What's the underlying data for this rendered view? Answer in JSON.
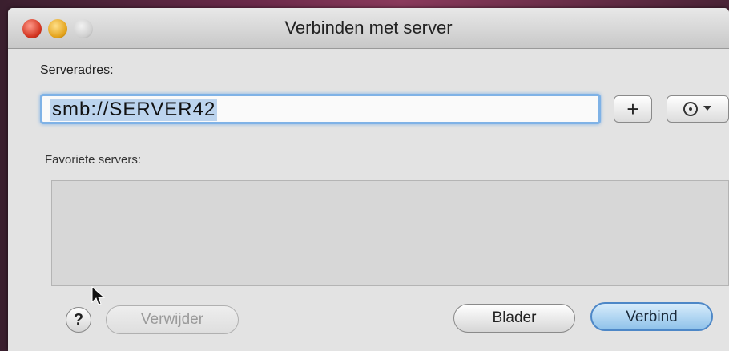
{
  "window": {
    "title": "Verbinden met server"
  },
  "form": {
    "server_label": "Serveradres:",
    "server_value": "smb://SERVER42",
    "add_label": "+",
    "favorites_label": "Favoriete servers:"
  },
  "footer": {
    "help_label": "?",
    "remove_label": "Verwijder",
    "browse_label": "Blader",
    "connect_label": "Verbind"
  },
  "colors": {
    "focus_ring": "#7fb2e6",
    "default_button": "#8fc2ea",
    "close": "#d2331f",
    "minimize": "#e3a21a"
  }
}
